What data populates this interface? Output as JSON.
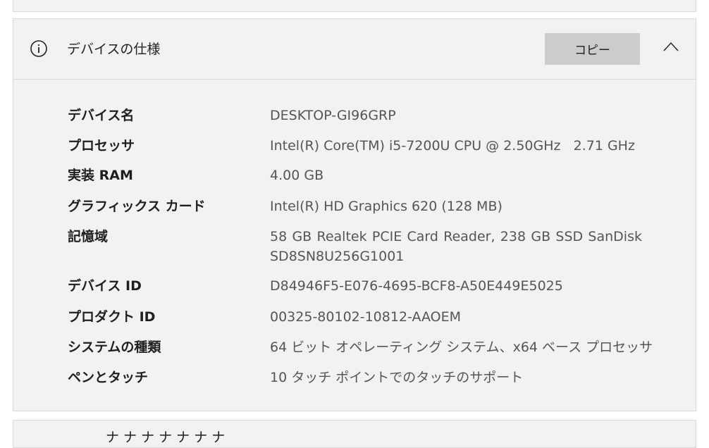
{
  "section": {
    "title": "デバイスの仕様",
    "copy_label": "コピー",
    "icons": {
      "info": "info-circle-icon",
      "collapse": "chevron-up-icon"
    }
  },
  "specs": [
    {
      "label": "デバイス名",
      "value": "DESKTOP-GI96GRP"
    },
    {
      "label": "プロセッサ",
      "value": "Intel(R) Core(TM) i5-7200U CPU @ 2.50GHz   2.71 GHz"
    },
    {
      "label": "実装 RAM",
      "value": "4.00 GB"
    },
    {
      "label": "グラフィックス カード",
      "value": "Intel(R) HD Graphics 620 (128 MB)"
    },
    {
      "label": "記憶域",
      "value": "58 GB Realtek PCIE Card Reader, 238 GB SSD SanDisk SD8SN8U256G1001"
    },
    {
      "label": "デバイス ID",
      "value": "D84946F5-E076-4695-BCF8-A50E449E5025"
    },
    {
      "label": "プロダクト ID",
      "value": "00325-80102-10812-AAOEM"
    },
    {
      "label": "システムの種類",
      "value": "64 ビット オペレーティング システム、x64 ベース プロセッサ"
    },
    {
      "label": "ペンとタッチ",
      "value": "10 タッチ ポイントでのタッチのサポート"
    }
  ],
  "next_section": {
    "title": "ナ  ナ  ナ  ナ  ナ  ナ  ナ"
  }
}
